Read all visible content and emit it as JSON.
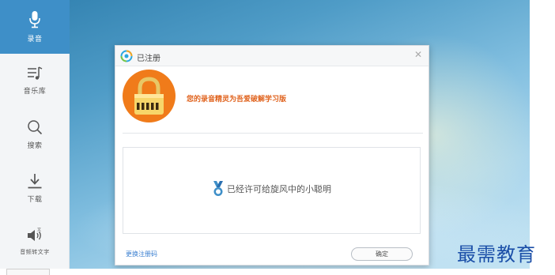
{
  "sidebar": {
    "items": [
      {
        "label": "录音",
        "icon": "microphone-icon"
      },
      {
        "label": "音乐库",
        "icon": "music-list-icon"
      },
      {
        "label": "搜索",
        "icon": "search-icon"
      },
      {
        "label": "下载",
        "icon": "download-icon"
      },
      {
        "label": "音频转文字",
        "icon": "speaker-icon"
      }
    ]
  },
  "dialog": {
    "title": "已注册",
    "close_glyph": "✕",
    "register_message": "您的录音精灵为吾爱破解学习版",
    "license_info": "已经许可给旋风中的小聪明",
    "change_code_link": "更换注册码",
    "ok_label": "确定"
  },
  "watermark": "最需教育",
  "colors": {
    "accent": "#3e8fc8",
    "lock_orange": "#f07b1a",
    "message_orange": "#e0631e",
    "link_blue": "#3a7fd0"
  }
}
